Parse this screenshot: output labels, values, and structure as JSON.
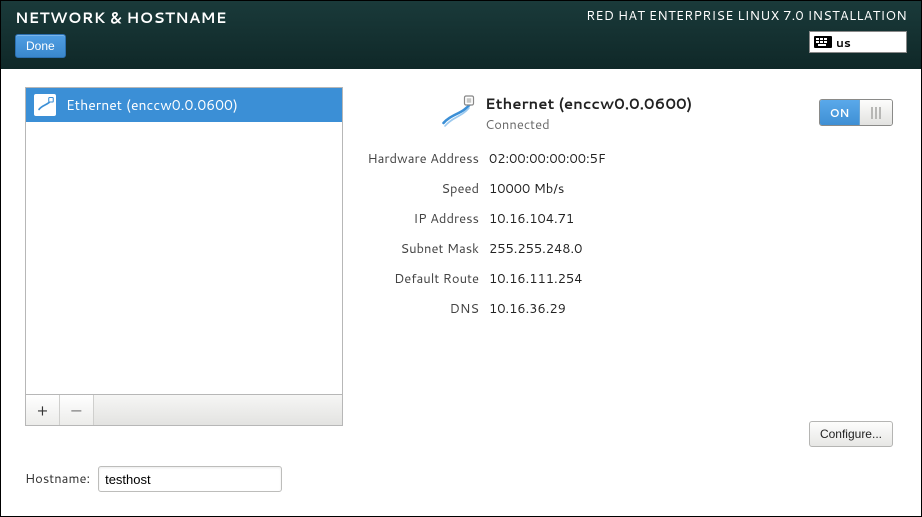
{
  "header": {
    "title": "NETWORK & HOSTNAME",
    "done": "Done",
    "subtitle": "RED HAT ENTERPRISE LINUX 7.0 INSTALLATION",
    "keyboard_layout": "us"
  },
  "devices": [
    {
      "label": "Ethernet (enccw0.0.0600)"
    }
  ],
  "toolbar": {
    "add": "+",
    "remove": "−"
  },
  "connection": {
    "name": "Ethernet (enccw0.0.0600)",
    "status": "Connected",
    "switch_on_label": "ON",
    "details": {
      "hw_label": "Hardware Address",
      "hw_value": "02:00:00:00:00:5F",
      "speed_label": "Speed",
      "speed_value": "10000 Mb/s",
      "ip_label": "IP Address",
      "ip_value": "10.16.104.71",
      "mask_label": "Subnet Mask",
      "mask_value": "255.255.248.0",
      "route_label": "Default Route",
      "route_value": "10.16.111.254",
      "dns_label": "DNS",
      "dns_value": "10.16.36.29"
    },
    "configure": "Configure..."
  },
  "hostname": {
    "label": "Hostname:",
    "value": "testhost"
  }
}
